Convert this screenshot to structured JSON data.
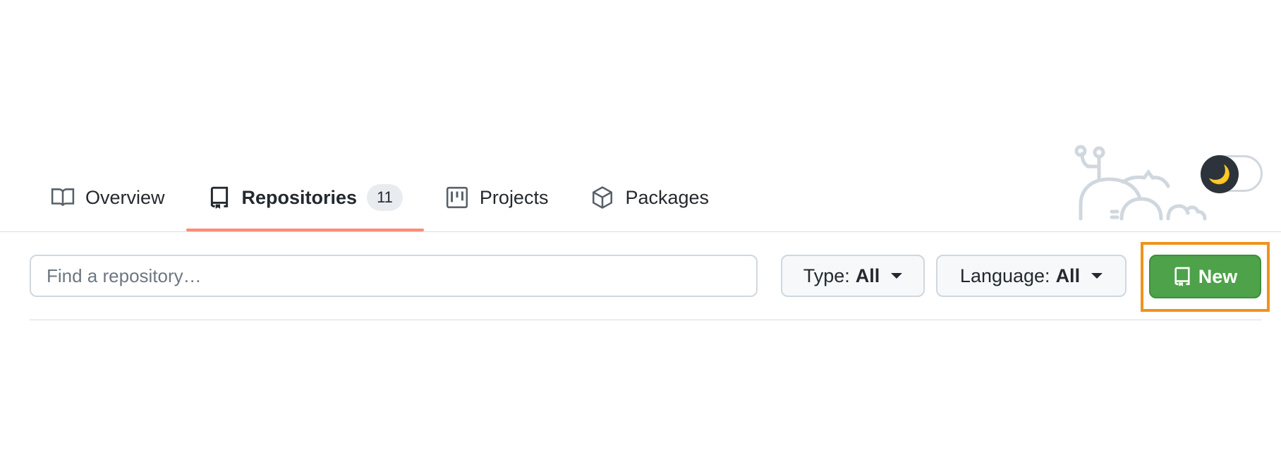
{
  "tabs": [
    {
      "label": "Overview",
      "icon": "book-icon",
      "selected": false
    },
    {
      "label": "Repositories",
      "icon": "repo-icon",
      "selected": true,
      "count": "11"
    },
    {
      "label": "Projects",
      "icon": "project-icon",
      "selected": false
    },
    {
      "label": "Packages",
      "icon": "package-icon",
      "selected": false
    }
  ],
  "theme_toggle": {
    "icon": "moon-icon",
    "glyph": "🌙"
  },
  "search": {
    "placeholder": "Find a repository…",
    "value": ""
  },
  "filters": {
    "type": {
      "label": "Type:",
      "value": "All"
    },
    "language": {
      "label": "Language:",
      "value": "All"
    }
  },
  "new_button": {
    "label": "New",
    "icon": "repo-icon"
  },
  "colors": {
    "accent_underline": "#fd8c73",
    "new_button": "#4ea24a",
    "highlight": "#f0921e"
  }
}
